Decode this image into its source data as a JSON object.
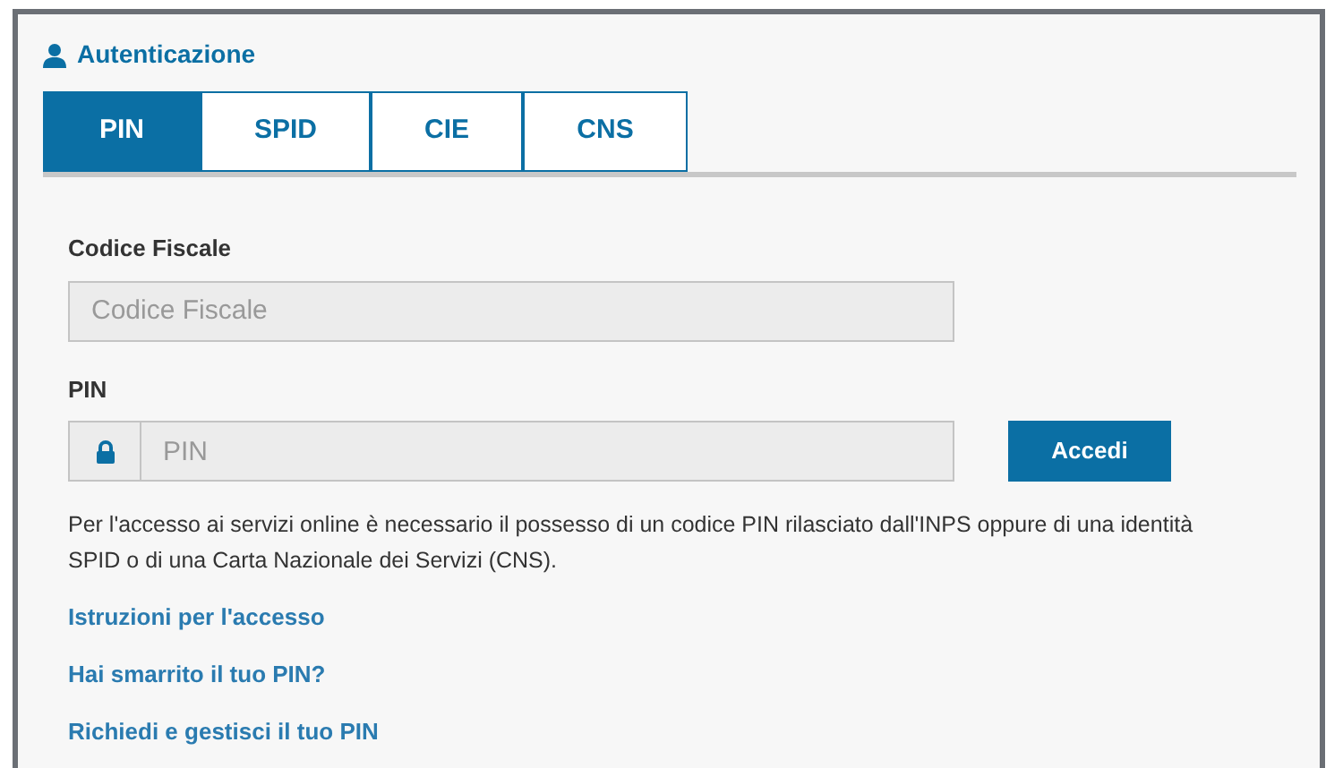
{
  "title": "Autenticazione",
  "tabs": [
    {
      "label": "PIN",
      "selected": true
    },
    {
      "label": "SPID",
      "selected": false
    },
    {
      "label": "CIE",
      "selected": false
    },
    {
      "label": "CNS",
      "selected": false
    }
  ],
  "fields": [
    {
      "label": "Codice Fiscale",
      "placeholder": "Codice Fiscale",
      "kind": "text"
    },
    {
      "label": "PIN",
      "placeholder": "PIN",
      "kind": "password"
    }
  ],
  "submit": "Accedi",
  "info": "Per l'accesso ai servizi online è necessario il possesso di un codice PIN rilasciato dall'INPS oppure di una identità SPID o di una Carta Nazionale dei Servizi (CNS).",
  "links": [
    "Istruzioni per l'accesso",
    "Hai smarrito il tuo PIN?",
    "Richiedi e gestisci il tuo PIN"
  ]
}
